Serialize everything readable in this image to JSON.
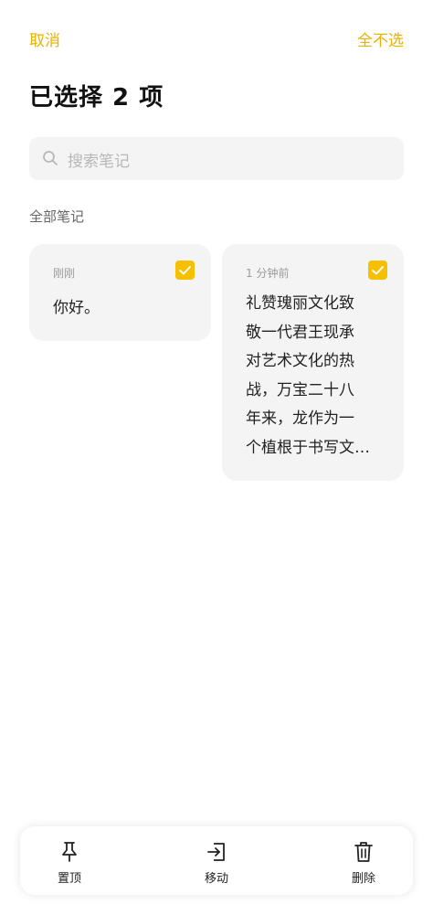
{
  "header": {
    "cancel_label": "取消",
    "deselect_all_label": "全不选",
    "title": "已选择 2 项"
  },
  "search": {
    "placeholder": "搜索笔记"
  },
  "section": {
    "label": "全部笔记"
  },
  "notes": [
    {
      "time": "刚刚",
      "lines": [
        "你好。"
      ],
      "selected": true
    },
    {
      "time": "1 分钟前",
      "lines": [
        "礼赞瑰丽文化致",
        "敬一代君王现承",
        "对艺术文化的热",
        "战，万宝二十八",
        "年来，龙作为一",
        "个植根于书写文…"
      ],
      "selected": true
    }
  ],
  "toolbar": {
    "pin_label": "置顶",
    "pin_icon": "pin-icon",
    "move_label": "移动",
    "move_icon": "move-icon",
    "delete_label": "删除",
    "delete_icon": "trash-icon"
  },
  "colors": {
    "accent": "#f6c000",
    "accent_text": "#e9b200",
    "card_bg": "#f4f4f4"
  }
}
